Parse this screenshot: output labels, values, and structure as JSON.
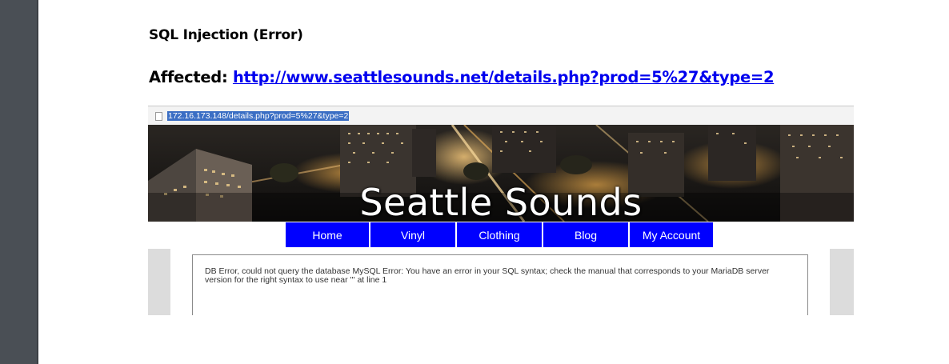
{
  "document": {
    "heading": "SQL Injection (Error)",
    "affected_label": "Affected:",
    "affected_url": "http://www.seattlesounds.net/details.php?prod=5%27&type=2"
  },
  "screenshot": {
    "address_bar_url": "172.16.173.148/details.php?prod=5%27&type=2",
    "site_title": "Seattle Sounds",
    "nav": [
      {
        "label": "Home"
      },
      {
        "label": "Vinyl"
      },
      {
        "label": "Clothing"
      },
      {
        "label": "Blog"
      },
      {
        "label": "My Account"
      }
    ],
    "error_message": "DB Error, could not query the database MySQL Error: You have an error in your SQL syntax; check the manual that corresponds to your MariaDB server version for the right syntax to use near ''' at line 1"
  },
  "colors": {
    "link": "#0000ee",
    "nav_bg": "#0000ff",
    "url_highlight": "#3a6ec4",
    "sidebar": "#4a4f55"
  }
}
